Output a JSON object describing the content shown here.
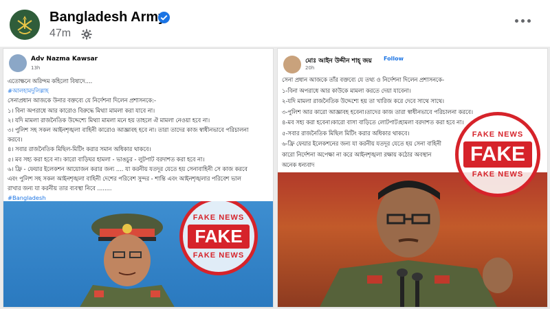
{
  "page": {
    "name": "Bangladesh Army",
    "time": "47m"
  },
  "left_post": {
    "author": "Adv Nazma Kawsar",
    "time": "13h",
    "lines": [
      "এতোক্ষনে অরিন্দম কহিলো বিষাদে....",
      "#আলহামদুলিল্লাহ",
      "সেনাপ্রধান আজকে উনার বক্তব্যে যে নির্দেশনা দিলেন প্রশাসনকে:-",
      "১। বিনা অপরাধে আর কারোও বিরুদ্ধে মিথ্যা মামলা করা যাবে না।",
      "২। যদি মামলা রাজনৈতিক উদ্দেশ্যে মিথ্যা মামলা মনে হয় তাহলে ঐ মামলা নেওয়া হবে না।",
      "৩। পুলিশ সহ সকল আইনশৃঙ্খলা বাহিনী কারোও আজ্ঞাবহ হবে না। তারা তাদের কাজ স্বাধীনভাবে পরিচালনা",
      "করবে।",
      "৪। সবার রাজনৈতিক মিছিল-মিটিং করার সমান অধিকার থাকবে।",
      "৫। মব সহ্য করা হবে না। কারো বাড়িঘর হামলা - ভাঙচুর - লুটপাট বরদাশত করা হবে না।",
      "৬। ফ্রি - ফেয়ার ইলেকশন আয়োজন করার জন্য .... যা করনীয় যতদূর যেতে হয় সেনাবাহিনী সে কাজ করবে",
      "এবং পুলিশ সহ সকল আইনশৃঙ্খলা বাহিনী দেশের পরিবেশ সুন্দর - শান্তি এবং আইনশৃঙ্খলার পরিবেশ ভাল",
      "রাখার জন্য যা করনীয় তার ব্যবস্থা নিবে ........"
    ],
    "hashtag": "#Bangladesh",
    "stamp": {
      "top": "FAKE NEWS",
      "main": "FAKE",
      "bottom": "FAKE NEWS"
    }
  },
  "right_post": {
    "author": "মোঃ আইন উদ্দীন শাহ্ জয়",
    "follow": "Follow",
    "time": "20h",
    "lines": [
      "সেনা প্রধান আজকে তাঁর বক্তব্যে যে তথ্য ও নির্দেশনা দিলেন প্রশাসনকে-",
      "১-বিনা অপরাধে আর কাউকে মামলা করতে দেয়া যাবেনা।",
      "২-যদি মামলা রাজনৈতিক উদ্দেশ্যে হয় তা খারিজ করে দেবে সাথে সাথে।",
      "৩-পুলিশ আর কারো আজ্ঞাবহ হবেনা।তাদের কাজ তারা স্বাধীনভাবে পরিচালনা করবে।",
      "৪-মব সহ্য করা হবেনা।কারো বাসা বাড়িতে লোটপাট।হামলা বরদাশত করা হবে না।",
      "৫-সবার রাজনৈতিক মিছিল মিটিং করার অধিকার থাকবে।",
      "৬-ফ্রি ফেয়ার ইলেকশনের জন্য যা করনীয় যতদূর যেতে হয় সেনা বাহিনী",
      "কারো নির্দেশনা অপেক্ষা না করে আইনশৃঙ্খলা রক্ষায় কঠোর অবস্থান",
      "অনেক ধন্যবাদ"
    ],
    "stamp": {
      "top": "FAKE NEWS",
      "main": "FAKE",
      "bottom": "FAKE NEWS"
    }
  },
  "colors": {
    "stamp_red": "#d6232a",
    "link_blue": "#1b74e4",
    "muted_gray": "#65676b"
  }
}
